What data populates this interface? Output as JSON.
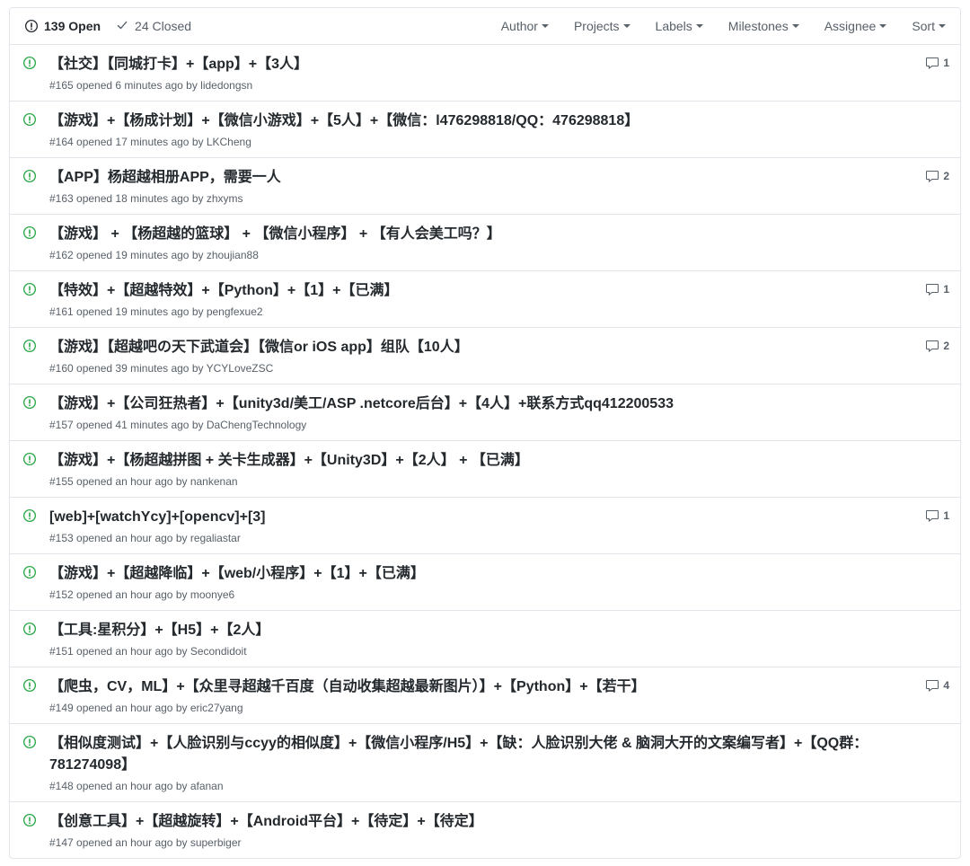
{
  "header": {
    "open": {
      "count": "139",
      "label": "Open"
    },
    "closed": {
      "count": "24",
      "label": "Closed"
    },
    "filters": {
      "author": "Author",
      "projects": "Projects",
      "labels": "Labels",
      "milestones": "Milestones",
      "assignee": "Assignee",
      "sort": "Sort"
    }
  },
  "issues": [
    {
      "title": "【社交】【同城打卡】+【app】+【3人】",
      "number": "#165",
      "time": "6 minutes ago",
      "author": "lidedongsn",
      "comments": "1"
    },
    {
      "title": "【游戏】+【杨成计划】+【微信小游戏】+【5人】+【微信：l476298818/QQ：476298818】",
      "number": "#164",
      "time": "17 minutes ago",
      "author": "LKCheng",
      "comments": ""
    },
    {
      "title": "【APP】杨超越相册APP，需要一人",
      "number": "#163",
      "time": "18 minutes ago",
      "author": "zhxyms",
      "comments": "2"
    },
    {
      "title": "【游戏】 + 【杨超越的篮球】 + 【微信小程序】 + 【有人会美工吗？】",
      "number": "#162",
      "time": "19 minutes ago",
      "author": "zhoujian88",
      "comments": ""
    },
    {
      "title": "【特效】+【超越特效】+【Python】+【1】+【已满】",
      "number": "#161",
      "time": "19 minutes ago",
      "author": "pengfexue2",
      "comments": "1"
    },
    {
      "title": "【游戏】【超越吧の天下武道会】【微信or iOS app】组队【10人】",
      "number": "#160",
      "time": "39 minutes ago",
      "author": "YCYLoveZSC",
      "comments": "2"
    },
    {
      "title": "【游戏】+【公司狂热者】+【unity3d/美工/ASP .netcore后台】+【4人】+联系方式qq412200533",
      "number": "#157",
      "time": "41 minutes ago",
      "author": "DaChengTechnology",
      "comments": ""
    },
    {
      "title": "【游戏】+【杨超越拼图 + 关卡生成器】+【Unity3D】+【2人】 + 【已满】",
      "number": "#155",
      "time": "an hour ago",
      "author": "nankenan",
      "comments": ""
    },
    {
      "title": "[web]+[watchYcy]+[opencv]+[3]",
      "number": "#153",
      "time": "an hour ago",
      "author": "regaliastar",
      "comments": "1"
    },
    {
      "title": "【游戏】+【超越降临】+【web/小程序】+【1】+【已满】",
      "number": "#152",
      "time": "an hour ago",
      "author": "moonye6",
      "comments": ""
    },
    {
      "title": "【工具:星积分】+【H5】+【2人】",
      "number": "#151",
      "time": "an hour ago",
      "author": "Secondidoit",
      "comments": ""
    },
    {
      "title": "【爬虫，CV，ML】+【众里寻超越千百度（自动收集超越最新图片）】+【Python】+【若干】",
      "number": "#149",
      "time": "an hour ago",
      "author": "eric27yang",
      "comments": "4"
    },
    {
      "title": "【相似度测试】+【人脸识别与ccyy的相似度】+【微信小程序/H5】+【缺：人脸识别大佬 & 脑洞大开的文案编写者】+【QQ群：781274098】",
      "number": "#148",
      "time": "an hour ago",
      "author": "afanan",
      "comments": ""
    },
    {
      "title": "【创意工具】+【超越旋转】+【Android平台】+【待定】+【待定】",
      "number": "#147",
      "time": "an hour ago",
      "author": "superbiger",
      "comments": ""
    }
  ]
}
